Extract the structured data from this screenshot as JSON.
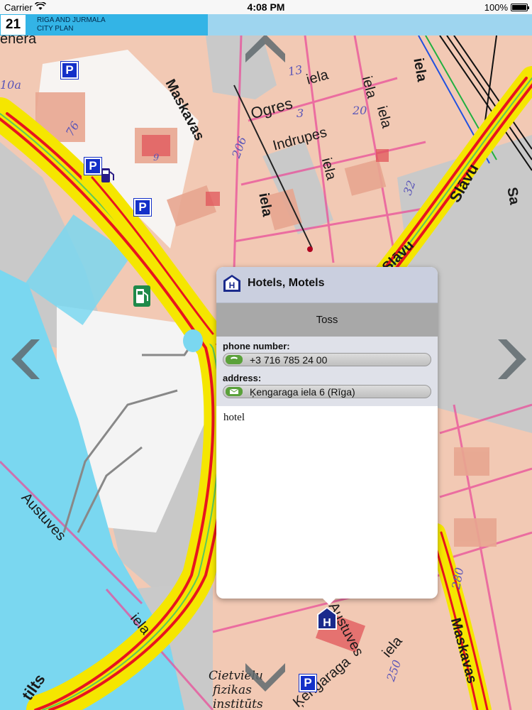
{
  "status_bar": {
    "carrier": "Carrier",
    "time": "4:08 PM",
    "battery": "100%"
  },
  "header": {
    "page_number": "21",
    "title_line1": "RIGA AND JURMALA",
    "title_line2": "CITY PLAN"
  },
  "map": {
    "street_labels": [
      {
        "text": "Maskavas",
        "id": "maskavas-top"
      },
      {
        "text": "iela",
        "id": "iela-1"
      },
      {
        "text": "Ogres",
        "id": "ogres"
      },
      {
        "text": "iela",
        "id": "iela-2"
      },
      {
        "text": "Indrupes",
        "id": "indrupes"
      },
      {
        "text": "iela",
        "id": "iela-3"
      },
      {
        "text": "iela",
        "id": "iela-4"
      },
      {
        "text": "iela",
        "id": "iela-5"
      },
      {
        "text": "Slāvu",
        "id": "slavu"
      },
      {
        "text": "Slāvu",
        "id": "slavu-2"
      },
      {
        "text": "Austuves",
        "id": "austuves-left"
      },
      {
        "text": "iela",
        "id": "iela-6"
      },
      {
        "text": "tilts",
        "id": "tilts"
      },
      {
        "text": "Austuves",
        "id": "austuves-bottom"
      },
      {
        "text": "iela",
        "id": "iela-7"
      },
      {
        "text": "Ķengaraga",
        "id": "kengaraga"
      },
      {
        "text": "Maskavas",
        "id": "maskavas-bottom"
      },
      {
        "text": "Cietvielu",
        "id": "cietvielu"
      },
      {
        "text": "fizikas",
        "id": "fizikas"
      },
      {
        "text": "institūts",
        "id": "instituts"
      },
      {
        "text": "iela",
        "id": "iela-8"
      },
      {
        "text": "Sa",
        "id": "sa-edge"
      },
      {
        "text": "enera",
        "id": "enera"
      }
    ],
    "house_numbers": [
      "10a",
      "76",
      "13",
      "20",
      "3",
      "206",
      "32",
      "280",
      "250",
      "9"
    ]
  },
  "popup": {
    "category": "Hotels, Motels",
    "name": "Toss",
    "phone_label": "phone number:",
    "phone_value": "+3 716 785 24 00",
    "address_label": "address:",
    "address_value": "Ķengaraga iela 6 (Rīga)",
    "description": "hotel"
  },
  "colors": {
    "header_dark": "#33b4e6",
    "header_light": "#9ed5ef",
    "parking": "#1430c8",
    "road_major": "#f5e600",
    "road_traffic": "#e8141e",
    "water": "#7ad7f0"
  },
  "icons": {
    "parking": "parking-icon",
    "fuel": "fuel-station-icon",
    "hotel": "hotel-icon",
    "phone": "phone-icon",
    "mail": "envelope-icon"
  }
}
